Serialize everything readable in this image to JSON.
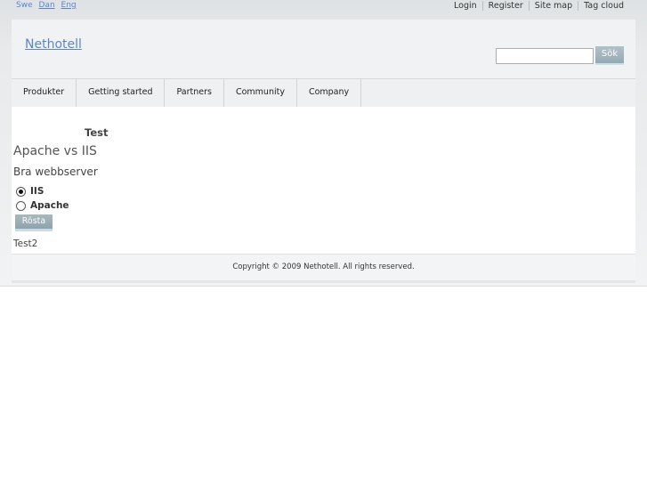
{
  "languages": [
    {
      "label": "Swe"
    },
    {
      "label": "Dan"
    },
    {
      "label": "Eng"
    }
  ],
  "toplinks": [
    "Login",
    "Register",
    "Site map",
    "Tag cloud"
  ],
  "header": {
    "logo": "Nethotell",
    "search_value": "",
    "search_button": "Sök"
  },
  "nav": [
    "Produkter",
    "Getting started",
    "Partners",
    "Community",
    "Company"
  ],
  "content": {
    "heading": "Test",
    "poll_title": "Apache vs IIS",
    "poll_question": "Bra webbserver",
    "options": [
      {
        "label": "IIS",
        "selected": true
      },
      {
        "label": "Apache",
        "selected": false
      }
    ],
    "vote_button": "Rösta",
    "footer_text": "Test2"
  },
  "footer": {
    "copyright": "Copyright © 2009 Nethotell. All rights reserved."
  }
}
